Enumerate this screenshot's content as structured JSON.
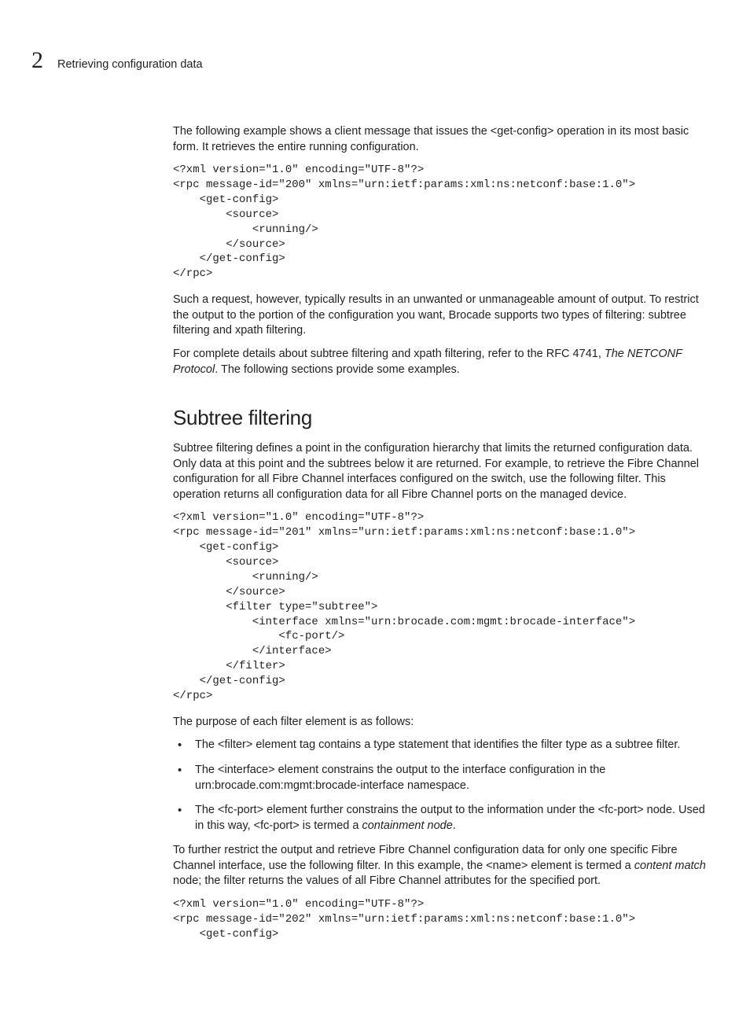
{
  "header": {
    "chapter_number": "2",
    "running_title": "Retrieving configuration data"
  },
  "body": {
    "intro_para": "The following example shows a client message that issues the <get-config> operation in its most basic form. It retrieves the entire running configuration.",
    "code1": "<?xml version=\"1.0\" encoding=\"UTF-8\"?>\n<rpc message-id=\"200\" xmlns=\"urn:ietf:params:xml:ns:netconf:base:1.0\">\n    <get-config>\n        <source>\n            <running/>\n        </source>\n    </get-config>\n</rpc>",
    "para_after_code1": "Such a request, however, typically results in an unwanted or unmanageable amount of output. To restrict the output to the portion of the configuration you want, Brocade supports two types of filtering: subtree filtering and xpath filtering.",
    "para_ref_pre": "For complete details about subtree filtering and xpath filtering, refer to the RFC 4741, ",
    "para_ref_ital": "The NETCONF Protocol",
    "para_ref_post": ". The following sections provide some examples.",
    "section_heading": "Subtree filtering",
    "subtree_para": "Subtree filtering defines a point in the configuration hierarchy that limits the returned configuration data. Only data at this point and the subtrees below it are returned. For example, to retrieve the Fibre Channel configuration for all Fibre Channel interfaces configured on the switch, use the following filter. This operation returns all configuration data for all Fibre Channel ports on the managed device.",
    "code2": "<?xml version=\"1.0\" encoding=\"UTF-8\"?>\n<rpc message-id=\"201\" xmlns=\"urn:ietf:params:xml:ns:netconf:base:1.0\">\n    <get-config>\n        <source>\n            <running/>\n        </source>\n        <filter type=\"subtree\">\n            <interface xmlns=\"urn:brocade.com:mgmt:brocade-interface\">\n                <fc-port/>\n            </interface>\n        </filter>\n    </get-config>\n</rpc>",
    "purpose_para": "The purpose of each filter element is as follows:",
    "bullets": {
      "b1": "The <filter> element tag contains a type statement that identifies the filter type as a subtree filter.",
      "b2": "The <interface> element constrains the output to the interface configuration in the urn:brocade.com:mgmt:brocade-interface namespace.",
      "b3_pre": "The <fc-port> element further constrains the output to the information under the <fc-port> node. Used in this way, <fc-port> is termed a ",
      "b3_ital": "containment node",
      "b3_post": "."
    },
    "restrict_pre": "To further restrict the output and retrieve Fibre Channel configuration data for only one specific Fibre Channel interface, use the following filter. In this example, the <name> element is termed a ",
    "restrict_ital": "content match",
    "restrict_post": " node; the filter returns the values of all Fibre Channel attributes for the specified port.",
    "code3": "<?xml version=\"1.0\" encoding=\"UTF-8\"?>\n<rpc message-id=\"202\" xmlns=\"urn:ietf:params:xml:ns:netconf:base:1.0\">\n    <get-config>"
  }
}
